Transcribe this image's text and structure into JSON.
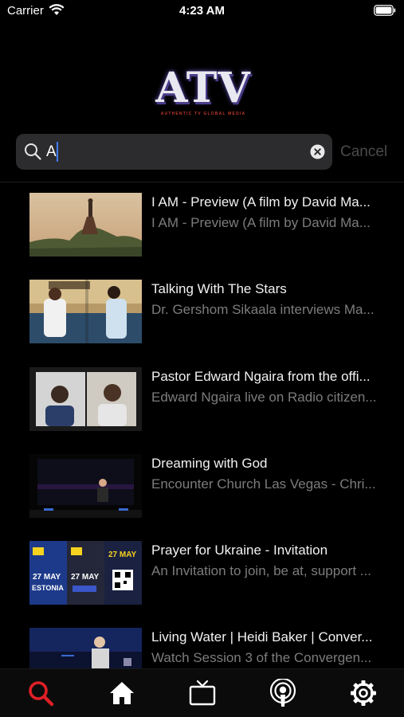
{
  "status_bar": {
    "carrier": "Carrier",
    "time": "4:23 AM"
  },
  "logo": {
    "title": "ATV",
    "subtitle": "AUTHENTIC TV GLOBAL MEDIA"
  },
  "search": {
    "value": "A",
    "placeholder": "Search",
    "cancel_label": "Cancel"
  },
  "results": [
    {
      "title": "I AM - Preview (A film by David Ma...",
      "subtitle": "I AM - Preview (A film by David Ma..."
    },
    {
      "title": "Talking With The Stars",
      "subtitle": "Dr. Gershom Sikaala interviews Ma..."
    },
    {
      "title": "Pastor Edward Ngaira from the offi...",
      "subtitle": "Edward Ngaira live on Radio citizen..."
    },
    {
      "title": "Dreaming with God",
      "subtitle": "Encounter Church Las Vegas - Chri..."
    },
    {
      "title": "Prayer for Ukraine - Invitation",
      "subtitle": "An Invitation to join, be at, support ..."
    },
    {
      "title": "Living Water | Heidi Baker | Conver...",
      "subtitle": "Watch Session 3 of the Convergen..."
    }
  ],
  "thumb_text": {
    "prayer_date": "27 MAY",
    "prayer_place": "ESTONIA"
  },
  "tabs": [
    {
      "name": "search",
      "icon": "search-icon",
      "active": true
    },
    {
      "name": "home",
      "icon": "home-icon",
      "active": false
    },
    {
      "name": "tv",
      "icon": "tv-icon",
      "active": false
    },
    {
      "name": "podcast",
      "icon": "podcast-icon",
      "active": false
    },
    {
      "name": "settings",
      "icon": "gear-icon",
      "active": false
    }
  ],
  "colors": {
    "accent": "#e01f26",
    "background": "#000000",
    "search_field": "#2c2c2e",
    "caret": "#3f7cff"
  }
}
